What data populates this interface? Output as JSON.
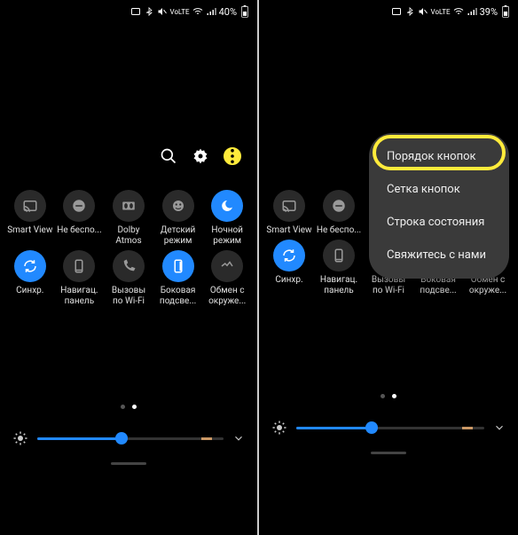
{
  "left": {
    "status": {
      "battery": "40%"
    },
    "tiles": [
      {
        "label": "Smart View",
        "on": false,
        "icon": "cast"
      },
      {
        "label": "Не беспо...",
        "on": false,
        "icon": "dnd"
      },
      {
        "label": "Dolby Atmos",
        "on": false,
        "icon": "dolby"
      },
      {
        "label": "Детский режим",
        "on": false,
        "icon": "child"
      },
      {
        "label": "Ночной режим",
        "on": true,
        "icon": "moon"
      },
      {
        "label": "Синхр.",
        "on": true,
        "icon": "sync"
      },
      {
        "label": "Навигац. панель",
        "on": false,
        "icon": "navbar"
      },
      {
        "label": "Вызовы по Wi-Fi",
        "on": false,
        "icon": "wificall"
      },
      {
        "label": "Боковая подсве...",
        "on": true,
        "icon": "edge"
      },
      {
        "label": "Обмен с окруже...",
        "on": false,
        "icon": "share"
      }
    ],
    "brightness": 45
  },
  "right": {
    "status": {
      "battery": "39%"
    },
    "tiles": [
      {
        "label": "Smart View",
        "on": false,
        "icon": "cast"
      },
      {
        "label": "Не беспо...",
        "on": false,
        "icon": "dnd"
      },
      {
        "label": "",
        "on": false,
        "icon": "none"
      },
      {
        "label": "",
        "on": false,
        "icon": "none"
      },
      {
        "label": "",
        "on": false,
        "icon": "none"
      },
      {
        "label": "Синхр.",
        "on": true,
        "icon": "sync"
      },
      {
        "label": "Навигац. панель",
        "on": false,
        "icon": "navbar"
      },
      {
        "label": "Вызовы по Wi-Fi",
        "on": false,
        "icon": "wificall"
      },
      {
        "label": "Боковая подсве...",
        "on": true,
        "icon": "edge"
      },
      {
        "label": "Обмен с окруже...",
        "on": false,
        "icon": "share"
      }
    ],
    "brightness": 40,
    "menu": [
      "Порядок кнопок",
      "Сетка кнопок",
      "Строка состояния",
      "Свяжитесь с нами"
    ]
  }
}
